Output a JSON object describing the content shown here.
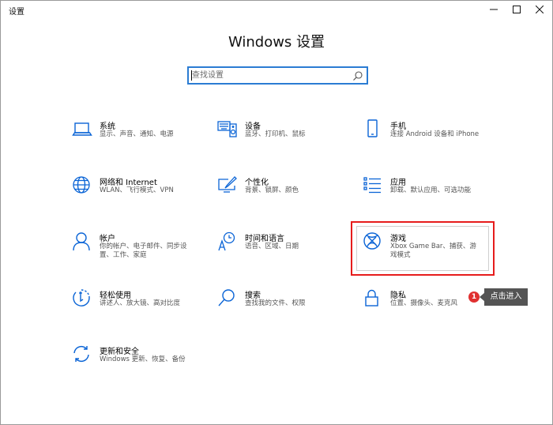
{
  "window": {
    "title": "设置",
    "minimize_icon": "minimize-icon",
    "maximize_icon": "maximize-icon",
    "close_icon": "close-icon"
  },
  "header": {
    "title": "Windows 设置"
  },
  "search": {
    "placeholder": "查找设置",
    "value": "",
    "icon": "search-icon"
  },
  "accent_color": "#0a64d6",
  "tiles": [
    {
      "title": "系统",
      "desc": "显示、声音、通知、电源",
      "icon": "laptop-icon"
    },
    {
      "title": "设备",
      "desc": "蓝牙、打印机、鼠标",
      "icon": "keyboard-speaker-icon"
    },
    {
      "title": "手机",
      "desc": "连接 Android 设备和 iPhone",
      "icon": "phone-icon"
    },
    {
      "title": "网络和 Internet",
      "desc": "WLAN、飞行模式、VPN",
      "icon": "globe-icon"
    },
    {
      "title": "个性化",
      "desc": "背景、锁屏、颜色",
      "icon": "paint-monitor-icon"
    },
    {
      "title": "应用",
      "desc": "卸载、默认应用、可选功能",
      "icon": "apps-list-icon"
    },
    {
      "title": "帐户",
      "desc": "你的帐户、电子邮件、同步设置、工作、家庭",
      "icon": "person-icon"
    },
    {
      "title": "时间和语言",
      "desc": "语音、区域、日期",
      "icon": "time-language-icon"
    },
    {
      "title": "游戏",
      "desc": "Xbox Game Bar、捕获、游戏模式",
      "icon": "xbox-icon"
    },
    {
      "title": "轻松使用",
      "desc": "讲述人、放大镜、高对比度",
      "icon": "ease-of-access-icon"
    },
    {
      "title": "搜索",
      "desc": "查找我的文件、权限",
      "icon": "magnifier-icon"
    },
    {
      "title": "隐私",
      "desc": "位置、摄像头、麦克风",
      "icon": "lock-icon"
    },
    {
      "title": "更新和安全",
      "desc": "Windows 更新、恢复、备份",
      "icon": "sync-arrows-icon"
    }
  ],
  "annotation": {
    "badge": "1",
    "tooltip": "点击进入",
    "highlight_color": "#e61c1c"
  }
}
